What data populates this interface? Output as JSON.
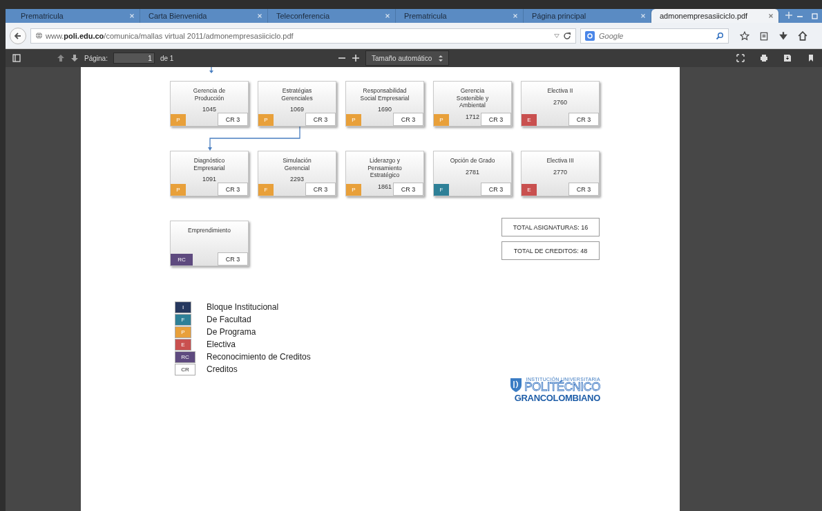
{
  "tabs": [
    {
      "title": "Prematricula",
      "selected": false
    },
    {
      "title": "Carta Bienvenida",
      "selected": false
    },
    {
      "title": "Teleconferencia",
      "selected": false
    },
    {
      "title": "Prematricula",
      "selected": false
    },
    {
      "title": "Página principal",
      "selected": false
    },
    {
      "title": "admonempresasiiciclo.pdf",
      "selected": true
    }
  ],
  "address_bar": {
    "url": "www.**poli.edu.co**/comunica/mallas virtual 2011/admonempresasiiciclo.pdf"
  },
  "search": {
    "placeholder": "Google"
  },
  "pdf_toolbar": {
    "page_label": "Página:",
    "page_value": "1",
    "page_total": "de 1",
    "zoom": "Tamaño automático"
  },
  "curriculum": {
    "rows": [
      [
        {
          "title": "Gerencia de Producción",
          "code": "1045",
          "badge": "P",
          "color": "#e8a03a",
          "credits": "CR 3"
        },
        {
          "title": "Estratégias Gerenciales",
          "code": "1069",
          "badge": "P",
          "color": "#e8a03a",
          "credits": "CR 3"
        },
        {
          "title": "Responsabilidad Social Empresarial",
          "code": "1690",
          "badge": "P",
          "color": "#e8a03a",
          "credits": "CR 3"
        },
        {
          "title": "Gerencia  Sostenible y Ambiental",
          "code": "1712",
          "badge": "P",
          "color": "#e8a03a",
          "credits": "CR 3"
        },
        {
          "title": "Electiva II",
          "code": "2760",
          "badge": "E",
          "color": "#c9504f",
          "credits": "CR 3"
        }
      ],
      [
        {
          "title": "Diagnóstico Empresarial",
          "code": "1091",
          "badge": "P",
          "color": "#e8a03a",
          "credits": "CR 3"
        },
        {
          "title": "Simulación Gerencial",
          "code": "2293",
          "badge": "F",
          "color": "#e8a03a",
          "credits": "CR 3"
        },
        {
          "title": "Liderazgo y Pensamiento Estratégico",
          "code": "1861",
          "badge": "P",
          "color": "#e8a03a",
          "credits": "CR 3"
        },
        {
          "title": "Opción de Grado",
          "code": "2781",
          "badge": "F",
          "color": "#2e8097",
          "credits": "CR 3"
        },
        {
          "title": "Electiva III",
          "code": "2770",
          "badge": "E",
          "color": "#c9504f",
          "credits": "CR 3"
        }
      ],
      [
        {
          "title": "Emprendimiento",
          "badge": "RC",
          "color": "#5e4a7f",
          "credits": "CR 3"
        }
      ]
    ]
  },
  "totals": [
    "TOTAL ASIGNATURAS: 16",
    "TOTAL DE CREDITOS: 48"
  ],
  "legend": [
    {
      "badge": "I",
      "label": "Bloque Institucional",
      "color": "#26385e"
    },
    {
      "badge": "F",
      "label": "De Facultad",
      "color": "#2e8097"
    },
    {
      "badge": "P",
      "label": "De Programa",
      "color": "#e8a03a"
    },
    {
      "badge": "E",
      "label": "Electiva",
      "color": "#c9504f"
    },
    {
      "badge": "RC",
      "label": "Reconocimiento de Creditos",
      "color": "#5e4a7f"
    },
    {
      "badge": "CR",
      "label": "Creditos",
      "color": "#ffffff"
    }
  ],
  "logo": {
    "tagline": "INSTITUCIÓN UNIVERSITARIA",
    "name": "POLITÉCNICO",
    "subname": "GRANCOLOMBIANO"
  }
}
